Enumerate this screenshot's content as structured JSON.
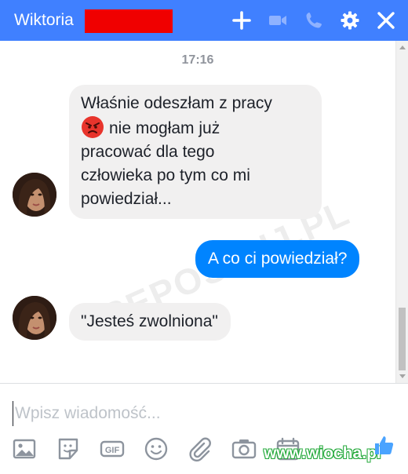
{
  "header": {
    "title": "Wiktoria",
    "background_color": "#4080ff",
    "icons": [
      "plus-icon",
      "video-camera-icon",
      "phone-icon",
      "gear-icon",
      "close-icon"
    ]
  },
  "conversation": {
    "timestamp": "17:16",
    "messages": [
      {
        "direction": "incoming",
        "emoji": "angry-face-icon",
        "lines": [
          "Właśnie odeszłam z pracy",
          "nie mogłam już",
          "pracować dla tego",
          "człowieka po tym co mi",
          "powiedział..."
        ]
      },
      {
        "direction": "outgoing",
        "text": "A co ci powiedział?"
      },
      {
        "direction": "incoming",
        "text": "\"Jesteś zwolniona\""
      }
    ],
    "incoming_bubble_color": "#f1f0f0",
    "outgoing_bubble_color": "#0084ff"
  },
  "watermark": "REPOSTUJ.PL",
  "composer": {
    "placeholder": "Wpisz wiadomość...",
    "tools": [
      "image-icon",
      "sticker-icon",
      "gif-icon",
      "emoji-icon",
      "paperclip-icon",
      "camera-icon",
      "calendar-icon"
    ],
    "gif_label": "GIF"
  },
  "site_watermark": {
    "text": "www.wiocha.pl",
    "color": "#23a93a"
  }
}
